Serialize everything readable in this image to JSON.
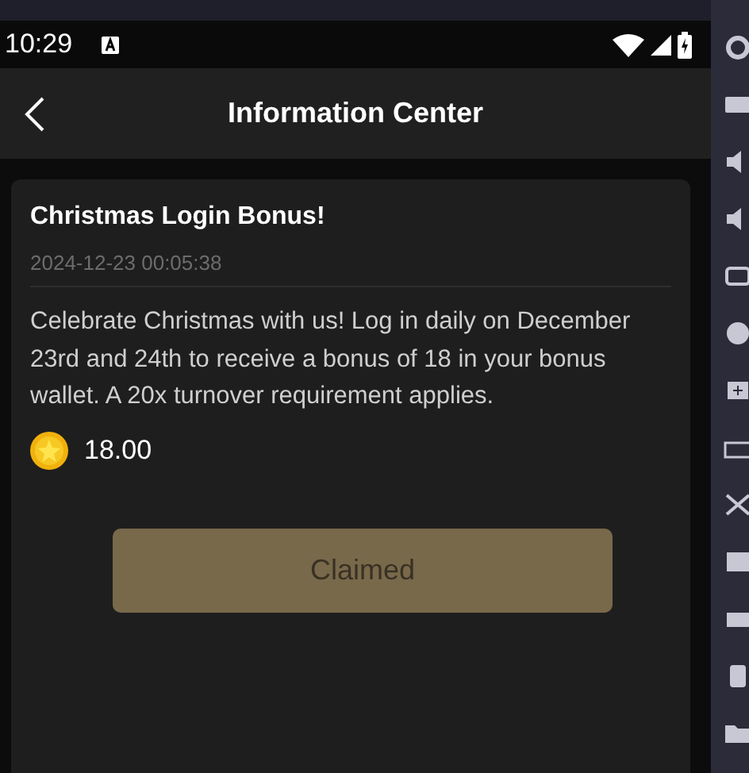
{
  "status_bar": {
    "time": "10:29"
  },
  "header": {
    "title": "Information Center"
  },
  "message": {
    "title": "Christmas Login Bonus!",
    "timestamp": "2024-12-23 00:05:38",
    "body": "Celebrate Christmas with us! Log in daily on December 23rd and 24th to receive a bonus of 18 in your bonus wallet. A 20x turnover requirement applies.",
    "amount": "18.00",
    "button": {
      "label": "Claimed",
      "disabled": true
    }
  }
}
